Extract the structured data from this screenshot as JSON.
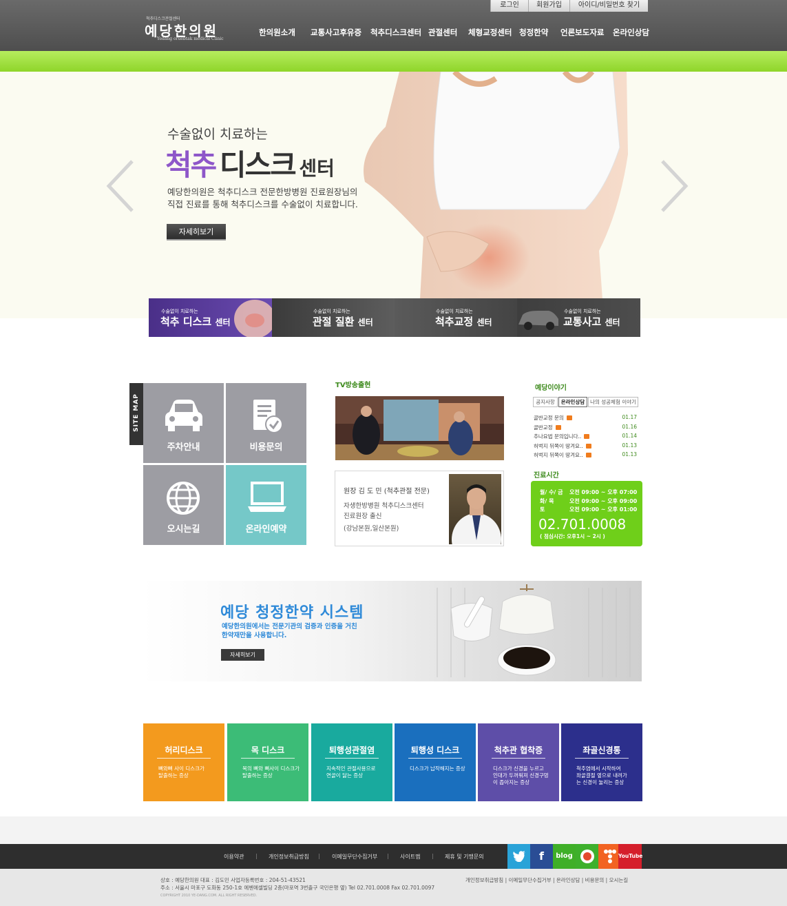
{
  "header": {
    "logo_small": "척추디스크관절센터",
    "logo_main": "예당한의원",
    "logo_en": "Yedang oruebtak medical Clinic",
    "util": [
      "로그인",
      "회원가입",
      "아이디/비밀번호 찾기"
    ],
    "nav": [
      "한의원소개",
      "교통사고후유증",
      "척추디스크센터",
      "관절센터",
      "체형교정센터",
      "청정한약",
      "언론보도자료",
      "온라인상담"
    ]
  },
  "hero": {
    "subtitle": "수술없이 치료하는",
    "title_a": "척추",
    "title_b": "디스크",
    "title_c": "센터",
    "desc_1": "예당한의원은 척추디스크 전문한방병원 진료원장님의",
    "desc_2": "직접 진료를 통해 척추디스크를 수술없이 치료합니다.",
    "button": "자세히보기"
  },
  "center_tabs": [
    {
      "small": "수술없이 치료하는",
      "title": "척추 디스크",
      "suffix": "센터",
      "color": "#5c3f9e"
    },
    {
      "small": "수술없이 치료하는",
      "title": "관절 질환",
      "suffix": "센터",
      "color": "#4a4a4a"
    },
    {
      "small": "수술없이 치료하는",
      "title": "척추교정",
      "suffix": "센터",
      "color": "#4e4e4e"
    },
    {
      "small": "수술없이 치료하는",
      "title": "교통사고",
      "suffix": "센터",
      "color": "#444444"
    }
  ],
  "sitemap": {
    "tag": "SITE MAP",
    "tiles": [
      {
        "label": "주차안내",
        "icon": "car-icon"
      },
      {
        "label": "비용문의",
        "icon": "document-check-icon"
      },
      {
        "label": "오시는길",
        "icon": "globe-icon"
      },
      {
        "label": "온라인예약",
        "icon": "laptop-icon"
      }
    ]
  },
  "tv": {
    "title": "TV방송출현",
    "doctor_name": "원장 김 도 민 (척추관절 전문)",
    "doctor_line1": "자생한방병원 척추디스크센터",
    "doctor_line2": "진료원장 출신",
    "doctor_line3": "(강남본원,일산본원)"
  },
  "story": {
    "title": "예당이야기",
    "tabs": [
      "공지사항",
      "온라인상담",
      "나의 성공체험 이야기"
    ],
    "items": [
      {
        "title": "골반교정 문의",
        "date": "01.17"
      },
      {
        "title": "골반교정",
        "date": "01.16"
      },
      {
        "title": "추나요법 문의입니다..",
        "date": "01.14"
      },
      {
        "title": "허벅지 뒤쪽이 땅겨요..",
        "date": "01.13"
      },
      {
        "title": "허벅지 뒤쪽이 땅겨요..",
        "date": "01.13"
      }
    ]
  },
  "hours": {
    "title": "진료시간",
    "rows": [
      {
        "day": "월/ 수/ 금",
        "time": "오전 09:00 ~ 오후 07:00"
      },
      {
        "day": "화/ 목",
        "time": "오전 09:00 ~ 오후 09:00"
      },
      {
        "day": "토",
        "time": "오전 09:00 ~ 오후 01:00"
      }
    ],
    "phone": "02.701.0008",
    "lunch": "( 점심시간: 오후1시 ~ 2시 )"
  },
  "herbal": {
    "title": "예당 청정한약 시스템",
    "desc_1": "예당한의원에서는 전문기관의 검증과 인증을 거친",
    "desc_2": "한약재만을 사용합니다.",
    "button": "자세히보기"
  },
  "diseases": [
    {
      "title": "허리디스크",
      "desc": "뼈와뼈 사이 디스크가\n탈출하는 증상",
      "color": "#f39a1e"
    },
    {
      "title": "목 디스크",
      "desc": "목의 뼈와 뼈사이 디스크가\n탈출하는 증상",
      "color": "#3cbc77"
    },
    {
      "title": "퇴행성관절염",
      "desc": "지속적인 관절사용으로\n연골이 닳는 증상",
      "color": "#19aa9e"
    },
    {
      "title": "퇴행성 디스크",
      "desc": "디스크가 납작해지는 증상",
      "color": "#1a6fbe"
    },
    {
      "title": "척추관 협착증",
      "desc": "디스크가 신경을 누르고\n인대가 두꺼워져 신경구멍\n이 좁아지는 증상",
      "color": "#5e4ea8"
    },
    {
      "title": "좌골신경통",
      "desc": "척추염에서 시작하여\n좌골결절 옆으로 내려가\n는 신경이 눌리는 증상",
      "color": "#2c2f8c"
    }
  ],
  "footer": {
    "links": [
      "이용약관",
      "개인정보취급방침",
      "이메일무단수집거부",
      "사이트맵",
      "제휴 및 기맹문의"
    ],
    "sns": [
      {
        "icon": "twitter-icon",
        "label": "",
        "color": "#2aa3d8"
      },
      {
        "icon": "facebook-icon",
        "label": "f",
        "color": "#2a4d95"
      },
      {
        "icon": "blog-icon",
        "label": "blog",
        "color": "#3faf28"
      },
      {
        "icon": "me2day-icon",
        "label": "",
        "color": "#3eb02c"
      },
      {
        "icon": "yozm-icon",
        "label": "",
        "color": "#f26322"
      },
      {
        "icon": "youtube-icon",
        "label": "YouTube",
        "color": "#d51f2b"
      }
    ],
    "info_1": "상호 : 예당한의원    대표 : 김도민    사업자등록번호 : 204-51-43521",
    "info_2": "주소 : 서울시 마포구 도화동 250-1호 에벤에셀빌딩 2층(마포역 3번출구 국민은행 옆)    Tel 02.701.0008    Fax 02.701.0097",
    "copyright": "COPYRIGHT 2010 YE-DANG.COM. ALL RIGHT RESERVED.",
    "right_links": "개인정보취급방침 | 이메일무단수집거부 | 온라인상담 | 비용문의 | 오시는길"
  }
}
